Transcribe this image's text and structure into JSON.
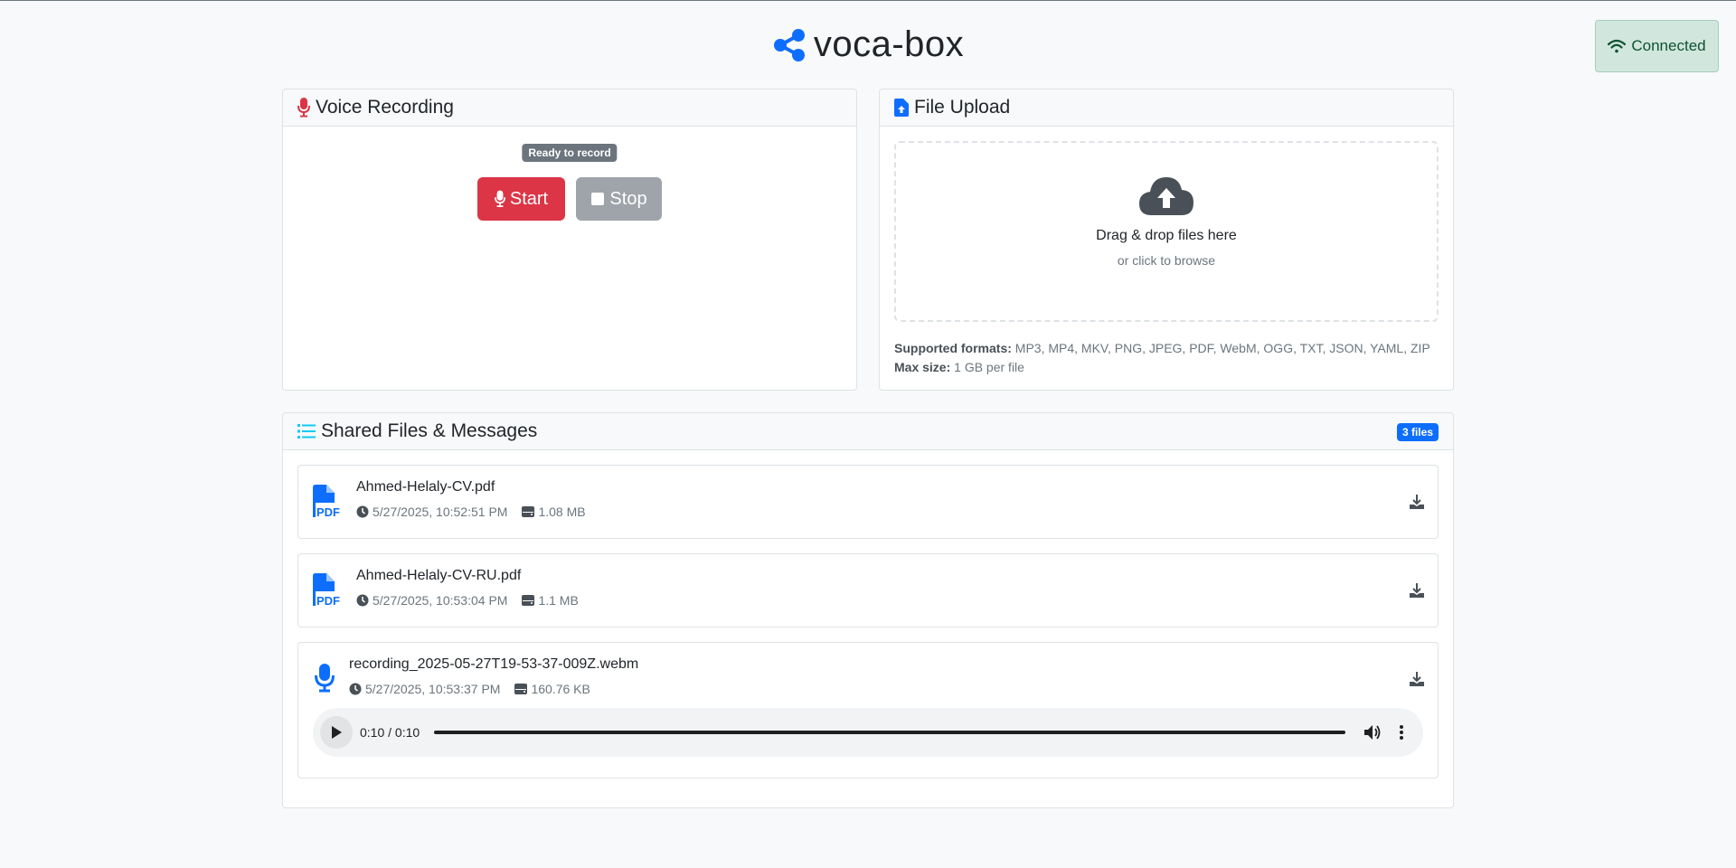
{
  "app": {
    "title": "voca-box"
  },
  "connection": {
    "label": "Connected",
    "color": "#0f5132"
  },
  "voice": {
    "title": "Voice Recording",
    "status": "Ready to record",
    "start_label": "Start",
    "stop_label": "Stop"
  },
  "upload": {
    "title": "File Upload",
    "drop_title": "Drag & drop files here",
    "drop_sub": "or click to browse",
    "formats_label": "Supported formats:",
    "formats_value": "MP3, MP4, MKV, PNG, JPEG, PDF, WebM, OGG, TXT, JSON, YAML, ZIP",
    "max_label": "Max size:",
    "max_value": "1 GB per file"
  },
  "shared": {
    "title": "Shared Files & Messages",
    "count_badge": "3 files",
    "files": [
      {
        "name": "Ahmed-Helaly-CV.pdf",
        "time": "5/27/2025, 10:52:51 PM",
        "size": "1.08 MB",
        "icon": "file-pdf-icon"
      },
      {
        "name": "Ahmed-Helaly-CV-RU.pdf",
        "time": "5/27/2025, 10:53:04 PM",
        "size": "1.1 MB",
        "icon": "file-pdf-icon"
      },
      {
        "name": "recording_2025-05-27T19-53-37-009Z.webm",
        "time": "5/27/2025, 10:53:37 PM",
        "size": "160.76 KB",
        "icon": "microphone-icon"
      }
    ],
    "player": {
      "time": "0:10 / 0:10",
      "progress": 1.0
    }
  },
  "colors": {
    "primary": "#0d6efd",
    "danger": "#dc3545",
    "secondary": "#6c757d",
    "info": "#0dcaf0"
  }
}
